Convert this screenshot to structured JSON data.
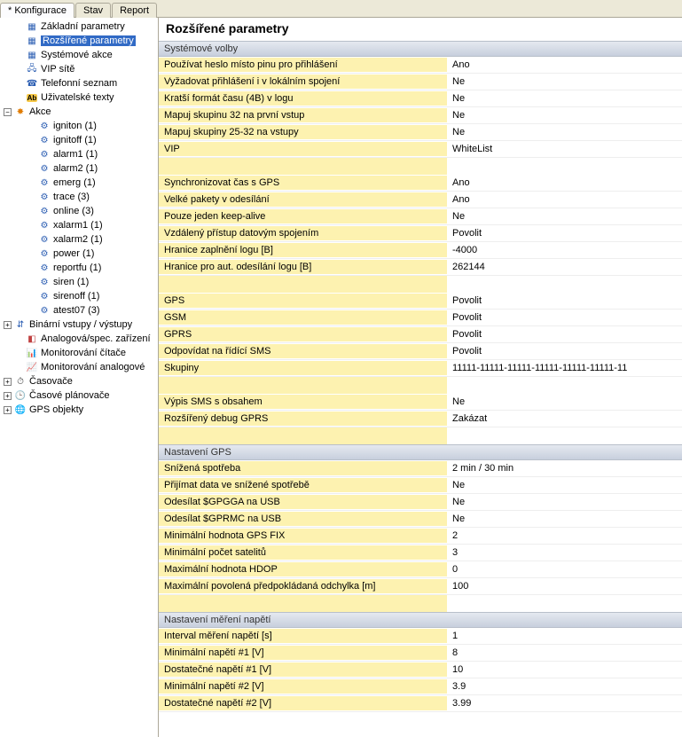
{
  "tabs": {
    "t0": "* Konfigurace",
    "t1": "Stav",
    "t2": "Report"
  },
  "tree": {
    "n0": "Základní parametry",
    "n1": "Rozšířené parametry",
    "n2": "Systémové akce",
    "n3": "VIP sítě",
    "n4": "Telefonní seznam",
    "n5": "Uživatelské texty",
    "n6": "Akce",
    "a0": "igniton (1)",
    "a1": "ignitoff (1)",
    "a2": "alarm1 (1)",
    "a3": "alarm2 (1)",
    "a4": "emerg (1)",
    "a5": "trace (3)",
    "a6": "online (3)",
    "a7": "xalarm1 (1)",
    "a8": "xalarm2 (1)",
    "a9": "power (1)",
    "a10": "reportfu (1)",
    "a11": "siren (1)",
    "a12": "sirenoff (1)",
    "a13": "atest07 (3)",
    "n7": "Binární vstupy / výstupy",
    "n8": "Analogová/spec. zařízení",
    "n9": "Monitorování čítače",
    "n10": "Monitorování analogové",
    "n11": "Časovače",
    "n12": "Časové plánovače",
    "n13": "GPS objekty"
  },
  "page_title": "Rozšířené parametry",
  "sections": {
    "s1": "Systémové volby",
    "s2": "Nastavení GPS",
    "s3": "Nastavení měření napětí"
  },
  "rows": {
    "r1l": "Používat heslo místo pinu pro přihlášení",
    "r1v": "Ano",
    "r2l": "Vyžadovat přihlášení i v lokálním spojení",
    "r2v": "Ne",
    "r3l": "Kratší formát času (4B) v logu",
    "r3v": "Ne",
    "r4l": "Mapuj skupinu 32 na první vstup",
    "r4v": "Ne",
    "r5l": "Mapuj skupiny 25-32 na vstupy",
    "r5v": "Ne",
    "r6l": "VIP",
    "r6v": "WhiteList",
    "r7l": "Synchronizovat čas s GPS",
    "r7v": "Ano",
    "r8l": "Velké pakety v odesílání",
    "r8v": "Ano",
    "r9l": "Pouze jeden keep-alive",
    "r9v": "Ne",
    "r10l": "Vzdálený přístup datovým spojením",
    "r10v": "Povolit",
    "r11l": "Hranice zaplnění logu [B]",
    "r11v": "-4000",
    "r12l": "Hranice pro aut. odesílání logu [B]",
    "r12v": "262144",
    "r13l": "GPS",
    "r13v": "Povolit",
    "r14l": "GSM",
    "r14v": "Povolit",
    "r15l": "GPRS",
    "r15v": "Povolit",
    "r16l": "Odpovídat na řídící SMS",
    "r16v": "Povolit",
    "r17l": "Skupiny",
    "r17v": "11111-11111-11111-11111-11111-11111-11",
    "r18l": "Výpis SMS s obsahem",
    "r18v": "Ne",
    "r19l": "Rozšířený debug GPRS",
    "r19v": "Zakázat",
    "r20l": "Snížená spotřeba",
    "r20v": "2 min / 30 min",
    "r21l": "Přijímat data ve snížené spotřebě",
    "r21v": "Ne",
    "r22l": "Odesílat $GPGGA na USB",
    "r22v": "Ne",
    "r23l": "Odesílat $GPRMC na USB",
    "r23v": "Ne",
    "r24l": "Minimální hodnota GPS FIX",
    "r24v": "2",
    "r25l": "Minimální počet satelitů",
    "r25v": "3",
    "r26l": "Maximální hodnota HDOP",
    "r26v": "0",
    "r27l": "Maximální povolená předpokládaná odchylka [m]",
    "r27v": "100",
    "r28l": "Interval měření napětí [s]",
    "r28v": "1",
    "r29l": "Minimální napětí #1 [V]",
    "r29v": "8",
    "r30l": "Dostatečné napětí #1 [V]",
    "r30v": "10",
    "r31l": "Minimální napětí #2 [V]",
    "r31v": "3.9",
    "r32l": "Dostatečné napětí #2 [V]",
    "r32v": "3.99"
  }
}
